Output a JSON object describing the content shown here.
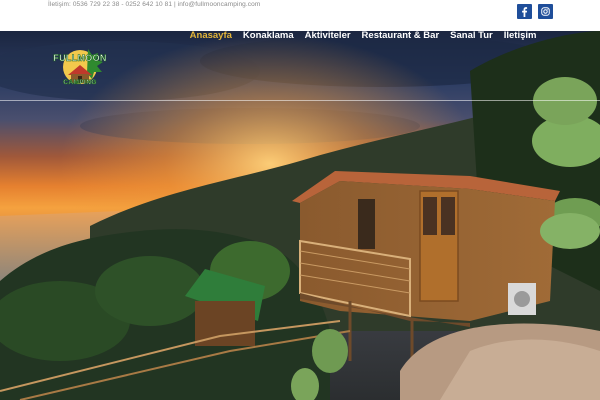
{
  "topbar": {
    "contact_text": "İletişim: 0536 729 22 38 - 0252 642 10 81 | info@fullmooncamping.com",
    "social": [
      {
        "icon": "facebook-icon"
      },
      {
        "icon": "instagram-icon"
      }
    ]
  },
  "brand": {
    "logo_line1": "FULLMOON",
    "logo_line2": "CAMPING"
  },
  "nav": {
    "items": [
      {
        "label": "Anasayfa",
        "active": true
      },
      {
        "label": "Konaklama",
        "active": false
      },
      {
        "label": "Aktiviteler",
        "active": false
      },
      {
        "label": "Restaurant & Bar",
        "active": false
      },
      {
        "label": "Sanal Tur",
        "active": false
      },
      {
        "label": "İletişim",
        "active": false
      }
    ]
  },
  "colors": {
    "accent_active": "#e3b53a",
    "social_bg": "#1f4e9a",
    "nav_text": "#ffffff"
  }
}
